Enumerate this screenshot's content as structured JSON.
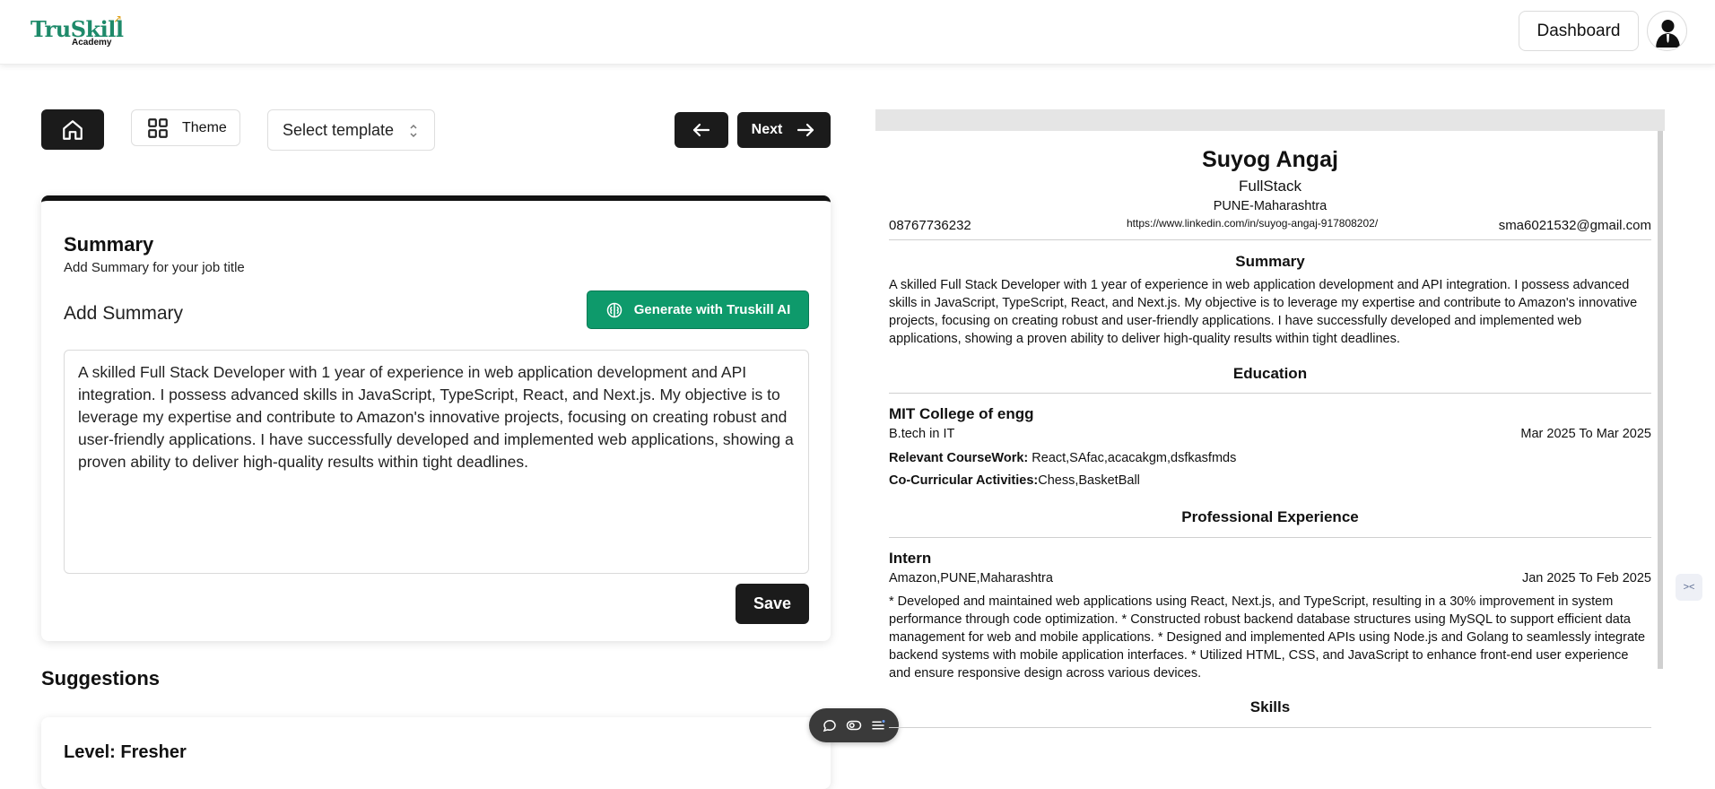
{
  "header": {
    "logo_text": "TruSkill",
    "logo_sub": "Academy",
    "dashboard_label": "Dashboard"
  },
  "toolbar": {
    "theme_label": "Theme",
    "template_select": "Select template",
    "next_label": "Next"
  },
  "summary_card": {
    "title": "Summary",
    "subtitle": "Add Summary for your job title",
    "add_label": "Add Summary",
    "ai_button": "Generate with Truskill AI",
    "text": "A skilled Full Stack Developer with 1 year of experience in web application development and API integration.  I possess advanced skills in JavaScript, TypeScript, React, and Next.js.  My objective is to leverage my expertise and contribute to Amazon's innovative projects, focusing on creating robust and user-friendly applications. I have successfully developed and implemented web applications, showing a proven ability to deliver high-quality results within tight deadlines.",
    "save_label": "Save"
  },
  "suggestions": {
    "title": "Suggestions",
    "level": "Level: Fresher"
  },
  "resume": {
    "name": "Suyog Angaj",
    "role": "FullStack",
    "location": "PUNE-Maharashtra",
    "phone": "08767736232",
    "linkedin": "https://www.linkedin.com/in/suyog-angaj-917808202/",
    "email": "sma6021532@gmail.com",
    "summary_heading": "Summary",
    "summary_text": "A skilled Full Stack Developer with 1 year of experience in web application development and API integration. I possess advanced skills in JavaScript, TypeScript, React, and Next.js. My objective is to leverage my expertise and contribute to Amazon's innovative projects, focusing on creating robust and user-friendly applications. I have successfully developed and implemented web applications, showing a proven ability to deliver high-quality results within tight deadlines.",
    "education_heading": "Education",
    "school": "MIT College of engg",
    "degree": "B.tech in IT",
    "edu_dates": "Mar 2025 To Mar 2025",
    "coursework_label": "Relevant CourseWork:",
    "coursework_value": " React,SAfac,acacakgm,dsfkasfmds",
    "activities_label": "Co-Curricular Activities:",
    "activities_value": "Chess,BasketBall",
    "experience_heading": "Professional Experience",
    "job_title": "Intern",
    "company": "Amazon,PUNE,Maharashtra",
    "job_dates": "Jan 2025 To Feb 2025",
    "job_desc": "* Developed and maintained web applications using React, Next.js, and TypeScript, resulting in a 30% improvement in system performance through code optimization. * Constructed robust backend database structures using MySQL to support efficient data management for web and mobile applications. * Designed and implemented APIs using Node.js and Golang to seamlessly integrate backend systems with mobile application interfaces. * Utilized HTML, CSS, and JavaScript to enhance front-end user experience and ensure responsive design across various devices.",
    "skills_heading": "Skills"
  },
  "colors": {
    "brand_green": "#1e8a6a",
    "ai_button": "#0e9a6b",
    "dark_button": "#1b1b1b"
  },
  "icons": [
    "home-icon",
    "grid-icon",
    "chevron-updown-icon",
    "arrow-left-icon",
    "arrow-right-icon",
    "brain-icon",
    "chat-icon",
    "toggle-icon",
    "menu-icon",
    "user-avatar-icon"
  ]
}
